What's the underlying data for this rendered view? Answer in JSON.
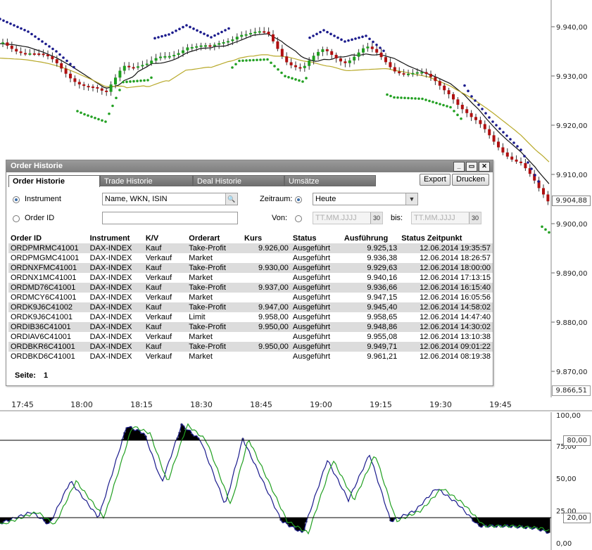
{
  "chart": {
    "price_axis": [
      "9.940,00",
      "9.930,00",
      "9.920,00",
      "9.910,00",
      "9.900,00",
      "9.890,00",
      "9.880,00",
      "9.870,00"
    ],
    "last_price": "9.904,88",
    "low_tag": "9.866,51",
    "time_axis": [
      "17:45",
      "18:00",
      "18:15",
      "18:30",
      "18:45",
      "19:00",
      "19:15",
      "19:30",
      "19:45"
    ],
    "osc_axis": [
      "100,00",
      "75,00",
      "50,00",
      "25,00",
      "0,00"
    ],
    "osc_tags": [
      "80,00",
      "20,00"
    ],
    "colors": {
      "up": "#1f9e1f",
      "down": "#b01010",
      "sar": "#1a1a8c",
      "ma_fast": "#111111",
      "ma_slow": "#b8a92a",
      "stoch_k": "#1a1a8c",
      "stoch_d": "#22a022"
    }
  },
  "window": {
    "title": "Order Historie",
    "tabs": [
      "Order Historie",
      "Trade Historie",
      "Deal Historie",
      "Umsätze"
    ],
    "export_label": "Export",
    "print_label": "Drucken",
    "instrument_label": "Instrument",
    "instrument_placeholder": "Name, WKN, ISIN",
    "orderid_label": "Order ID",
    "zeitraum_label": "Zeitraum:",
    "zeitraum_value": "Heute",
    "von_label": "Von:",
    "bis_label": "bis:",
    "date_placeholder": "TT.MM.JJJJ",
    "columns": [
      "Order ID",
      "Instrument",
      "K/V",
      "Orderart",
      "Kurs",
      "Status",
      "Ausführung",
      "Status Zeitpunkt"
    ],
    "rows": [
      [
        "ORDPMRMC41001",
        "DAX-INDEX",
        "Kauf",
        "Take-Profit",
        "9.926,00",
        "Ausgeführt",
        "9.925,13",
        "12.06.2014 19:35:57"
      ],
      [
        "ORDPMGMC41001",
        "DAX-INDEX",
        "Verkauf",
        "Market",
        "",
        "Ausgeführt",
        "9.936,38",
        "12.06.2014 18:26:57"
      ],
      [
        "ORDNXFMC41001",
        "DAX-INDEX",
        "Kauf",
        "Take-Profit",
        "9.930,00",
        "Ausgeführt",
        "9.929,63",
        "12.06.2014 18:00:00"
      ],
      [
        "ORDNX1MC41001",
        "DAX-INDEX",
        "Verkauf",
        "Market",
        "",
        "Ausgeführt",
        "9.940,16",
        "12.06.2014 17:13:15"
      ],
      [
        "ORDMD76C41001",
        "DAX-INDEX",
        "Kauf",
        "Take-Profit",
        "9.937,00",
        "Ausgeführt",
        "9.936,66",
        "12.06.2014 16:15:40"
      ],
      [
        "ORDMCY6C41001",
        "DAX-INDEX",
        "Verkauf",
        "Market",
        "",
        "Ausgeführt",
        "9.947,15",
        "12.06.2014 16:05:56"
      ],
      [
        "ORDK9J6C41002",
        "DAX-INDEX",
        "Kauf",
        "Take-Profit",
        "9.947,00",
        "Ausgeführt",
        "9.945,40",
        "12.06.2014 14:58:02"
      ],
      [
        "ORDK9J6C41001",
        "DAX-INDEX",
        "Verkauf",
        "Limit",
        "9.958,00",
        "Ausgeführt",
        "9.958,65",
        "12.06.2014 14:47:40"
      ],
      [
        "ORDIB36C41001",
        "DAX-INDEX",
        "Kauf",
        "Take-Profit",
        "9.950,00",
        "Ausgeführt",
        "9.948,86",
        "12.06.2014 14:30:02"
      ],
      [
        "ORDIAV6C41001",
        "DAX-INDEX",
        "Verkauf",
        "Market",
        "",
        "Ausgeführt",
        "9.955,08",
        "12.06.2014 13:10:38"
      ],
      [
        "ORDBKR6C41001",
        "DAX-INDEX",
        "Kauf",
        "Take-Profit",
        "9.950,00",
        "Ausgeführt",
        "9.949,71",
        "12.06.2014 09:01:22"
      ],
      [
        "ORDBKD6C41001",
        "DAX-INDEX",
        "Verkauf",
        "Market",
        "",
        "Ausgeführt",
        "9.961,21",
        "12.06.2014 08:19:38"
      ]
    ],
    "page_label": "Seite:",
    "page_value": "1"
  }
}
